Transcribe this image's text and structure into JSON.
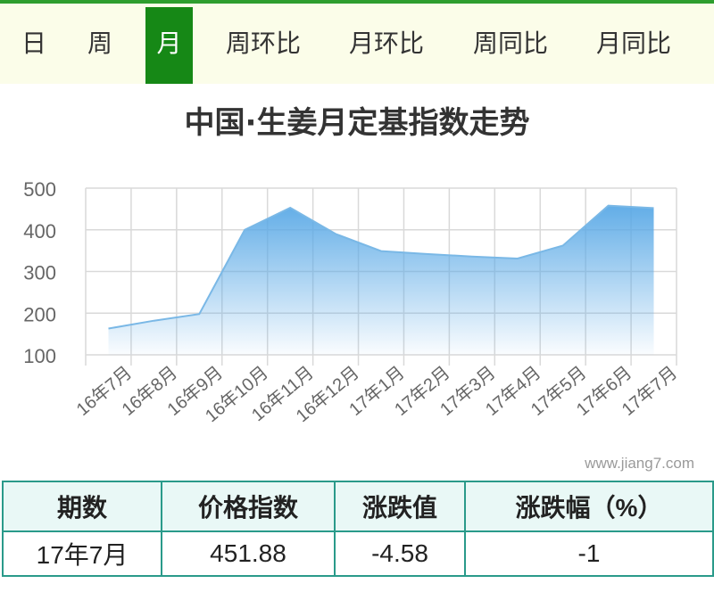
{
  "tabs": [
    {
      "label": "日",
      "active": false
    },
    {
      "label": "周",
      "active": false
    },
    {
      "label": "月",
      "active": true
    },
    {
      "label": "周环比",
      "active": false
    },
    {
      "label": "月环比",
      "active": false
    },
    {
      "label": "周同比",
      "active": false
    },
    {
      "label": "月同比",
      "active": false
    }
  ],
  "colors": {
    "tab_active": "#168816",
    "tab_bar_bg": "#fbfde9",
    "line": "#7ab8e6",
    "area_top": "#5aa9e6",
    "table_border": "#2a9a8a"
  },
  "chart_data": {
    "type": "area",
    "title": "中国·生姜月定基指数走势",
    "categories": [
      "16年7月",
      "16年8月",
      "16年9月",
      "16年10月",
      "16年11月",
      "16年12月",
      "17年1月",
      "17年2月",
      "17年3月",
      "17年4月",
      "17年5月",
      "17年6月",
      "17年7月"
    ],
    "series": [
      {
        "values": [
          163,
          182,
          198,
          400,
          453,
          390,
          349,
          342,
          336,
          331,
          362,
          458,
          452
        ]
      }
    ],
    "yticks": [
      100,
      200,
      300,
      400,
      500
    ],
    "ylim": [
      100,
      500
    ],
    "grid": true,
    "legend": "none"
  },
  "watermark": "www.jiang7.com",
  "table": {
    "headers": [
      "期数",
      "价格指数",
      "涨跌值",
      "涨跌幅（%）"
    ],
    "rows": [
      [
        "17年7月",
        "451.88",
        "-4.58",
        "-1"
      ]
    ]
  }
}
